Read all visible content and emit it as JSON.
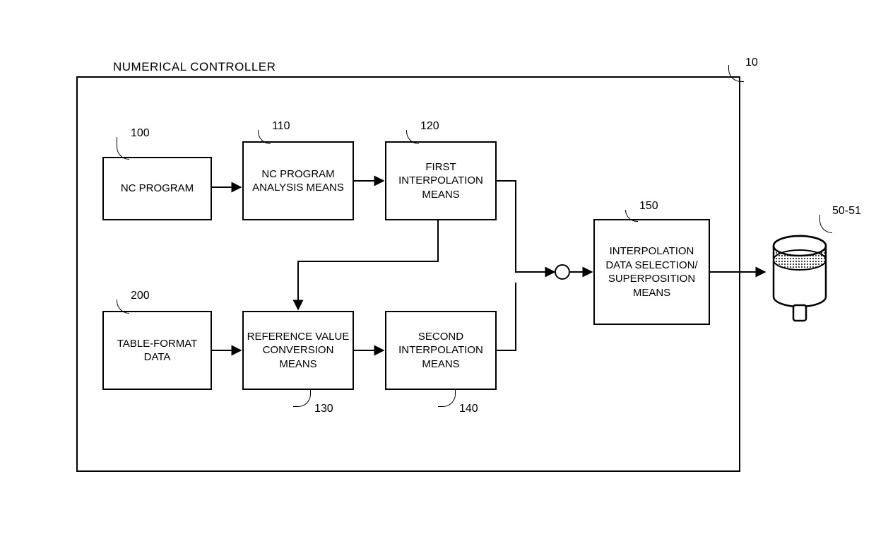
{
  "outer": {
    "title": "NUMERICAL CONTROLLER",
    "ref": "10"
  },
  "blocks": {
    "nc_program": {
      "label": "NC PROGRAM",
      "ref": "100"
    },
    "nc_analysis": {
      "label": "NC PROGRAM ANALYSIS MEANS",
      "ref": "110"
    },
    "first_interp": {
      "label": "FIRST INTERPOLATION MEANS",
      "ref": "120"
    },
    "table_data": {
      "label": "TABLE-FORMAT DATA",
      "ref": "200"
    },
    "ref_conv": {
      "label": "REFERENCE VALUE CONVERSION MEANS",
      "ref": "130"
    },
    "second_interp": {
      "label": "SECOND INTERPOLATION MEANS",
      "ref": "140"
    },
    "sel_super": {
      "label": "INTERPOLATION DATA SELECTION/ SUPERPOSITION MEANS",
      "ref": "150"
    }
  },
  "motor": {
    "ref": "50-51"
  }
}
